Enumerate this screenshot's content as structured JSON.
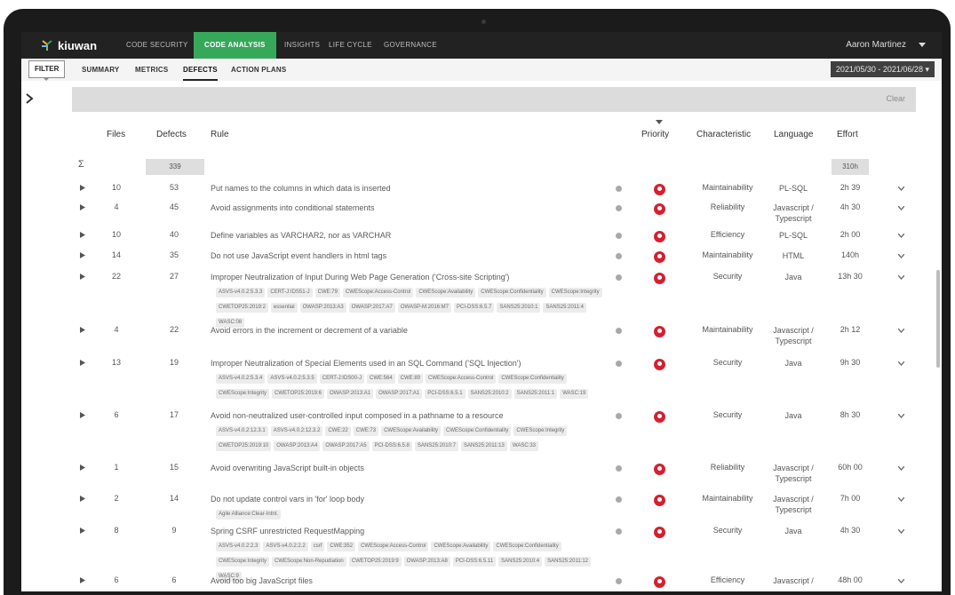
{
  "app": {
    "logo_text": "kiuwan",
    "user_name": "Aaron Martinez",
    "accent": "#36a85a",
    "priority_color": "#d42030"
  },
  "topnav": [
    {
      "label": "CODE SECURITY",
      "active": false
    },
    {
      "label": "CODE ANALYSIS",
      "active": true
    },
    {
      "label": "INSIGHTS",
      "active": false
    },
    {
      "label": "LIFE CYCLE",
      "active": false
    },
    {
      "label": "GOVERNANCE",
      "active": false
    }
  ],
  "subnav": {
    "filter_label": "FILTER",
    "tabs": [
      {
        "label": "SUMMARY",
        "active": false
      },
      {
        "label": "METRICS",
        "active": false
      },
      {
        "label": "DEFECTS",
        "active": true
      },
      {
        "label": "ACTION PLANS",
        "active": false
      }
    ],
    "date_range": "2021/05/30 - 2021/06/28"
  },
  "filter_bar": {
    "clear_label": "Clear"
  },
  "table": {
    "headers": {
      "files": "Files",
      "defects": "Defects",
      "rule": "Rule",
      "priority": "Priority",
      "characteristic": "Characteristic",
      "language": "Language",
      "effort": "Effort"
    },
    "totals": {
      "symbol": "Σ",
      "defects": "339",
      "effort": "310h"
    },
    "rows": [
      {
        "files": "10",
        "defects": "53",
        "rule": "Put names to the columns in which data is inserted",
        "tags": [],
        "characteristic": "Maintainability",
        "language": "PL-SQL",
        "effort": "2h 39"
      },
      {
        "files": "4",
        "defects": "45",
        "rule": "Avoid assignments into conditional statements",
        "tags": [],
        "characteristic": "Reliability",
        "language": "Javascript / Typescript",
        "effort": "4h 30"
      },
      {
        "files": "10",
        "defects": "40",
        "rule": "Define variables as VARCHAR2, nor as VARCHAR",
        "tags": [],
        "characteristic": "Efficiency",
        "language": "PL-SQL",
        "effort": "2h 00"
      },
      {
        "files": "14",
        "defects": "35",
        "rule": "Do not use JavaScript event handlers in html tags",
        "tags": [],
        "characteristic": "Maintainability",
        "language": "HTML",
        "effort": "140h"
      },
      {
        "files": "22",
        "defects": "27",
        "rule": "Improper Neutralization of Input During Web Page Generation ('Cross-site Scripting')",
        "tags": [
          "ASVS-v4.0.2:5.3.3",
          "CERT-J:IDS51-J",
          "CWE:79",
          "CWEScope:Access-Control",
          "CWEScope:Availability",
          "CWEScope:Confidentiality",
          "CWEScope:Integrity",
          "CWETOP25:2019:2",
          "essential",
          "OWASP:2013:A3",
          "OWASP:2017:A7",
          "OWASP-M:2016:M7",
          "PCI-DSS:6.5.7",
          "SANS25:2010:1",
          "SANS25:2011:4",
          "WASC:08"
        ],
        "characteristic": "Security",
        "language": "Java",
        "effort": "13h 30"
      },
      {
        "files": "4",
        "defects": "22",
        "rule": "Avoid errors in the increment or decrement of a variable",
        "tags": [],
        "characteristic": "Maintainability",
        "language": "Javascript / Typescript",
        "effort": "2h 12"
      },
      {
        "files": "13",
        "defects": "19",
        "rule": "Improper Neutralization of Special Elements used in an SQL Command ('SQL Injection')",
        "tags": [
          "ASVS-v4.0.2:5.3.4",
          "ASVS-v4.0.2:5.3.5",
          "CERT-J:IDS00-J",
          "CWE:564",
          "CWE:89",
          "CWEScope:Access-Control",
          "CWEScope:Confidentiality",
          "CWEScope:Integrity",
          "CWETOP25:2019:6",
          "OWASP:2013:A1",
          "OWASP:2017:A1",
          "PCI-DSS:6.5.1",
          "SANS25:2010:2",
          "SANS25:2011:1",
          "WASC:19"
        ],
        "characteristic": "Security",
        "language": "Java",
        "effort": "9h 30"
      },
      {
        "files": "6",
        "defects": "17",
        "rule": "Avoid non-neutralized user-controlled input composed in a pathname to a resource",
        "tags": [
          "ASVS-v4.0.2:12.3.1",
          "ASVS-v4.0.2:12.3.2",
          "CWE:22",
          "CWE:73",
          "CWEScope:Availability",
          "CWEScope:Confidentiality",
          "CWEScope:Integrity",
          "CWETOP25:2019:10",
          "OWASP:2013:A4",
          "OWASP:2017:A5",
          "PCI-DSS:6.5.8",
          "SANS25:2010:7",
          "SANS25:2011:13",
          "WASC:33"
        ],
        "characteristic": "Security",
        "language": "Java",
        "effort": "8h 30"
      },
      {
        "files": "1",
        "defects": "15",
        "rule": "Avoid overwriting JavaScript built-in objects",
        "tags": [],
        "characteristic": "Reliability",
        "language": "Javascript / Typescript",
        "effort": "60h 00"
      },
      {
        "files": "2",
        "defects": "14",
        "rule": "Do not update control vars in 'for' loop body",
        "tags": [
          "Agile Alliance:Clear-Intnt."
        ],
        "characteristic": "Maintainability",
        "language": "Javascript / Typescript",
        "effort": "7h 00"
      },
      {
        "files": "8",
        "defects": "9",
        "rule": "Spring CSRF unrestricted RequestMapping",
        "tags": [
          "ASVS-v4.0.2:2.3",
          "ASVS-v4.0.2:2.2",
          "csrf",
          "CWE:352",
          "CWEScope:Access-Control",
          "CWEScope:Availability",
          "CWEScope:Confidentiality",
          "CWEScope:Integrity",
          "CWEScope:Non-Repudiation",
          "CWETOP25:2019:9",
          "OWASP:2013:A8",
          "PCI-DSS:6.5.11",
          "SANS25:2010:4",
          "SANS25:2011:12",
          "WASC:9"
        ],
        "characteristic": "Security",
        "language": "Java",
        "effort": "4h 30"
      },
      {
        "files": "6",
        "defects": "6",
        "rule": "Avoid too big JavaScript files",
        "tags": [],
        "characteristic": "Efficiency",
        "language": "Javascript /",
        "effort": "48h 00"
      }
    ]
  }
}
